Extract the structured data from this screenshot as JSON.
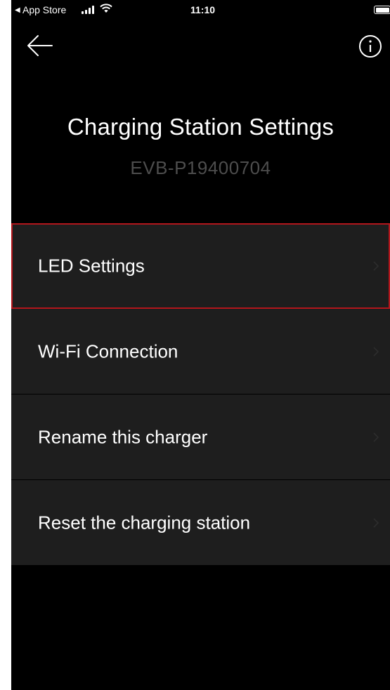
{
  "status_bar": {
    "back_app": "App Store",
    "time": "11:10"
  },
  "header": {
    "title": "Charging Station Settings",
    "serial": "EVB-P19400704"
  },
  "menu": {
    "items": [
      {
        "label": "LED Settings",
        "selected": true
      },
      {
        "label": "Wi-Fi Connection"
      },
      {
        "label": "Rename this charger"
      },
      {
        "label": "Reset the charging station"
      }
    ]
  },
  "colors": {
    "background": "#000000",
    "menu_item": "#1e1e1e",
    "selection_border": "#b3161c",
    "subtitle": "#4d4d4d"
  },
  "icons": [
    "back-arrow-icon",
    "info-icon",
    "chevron-right-icon"
  ]
}
